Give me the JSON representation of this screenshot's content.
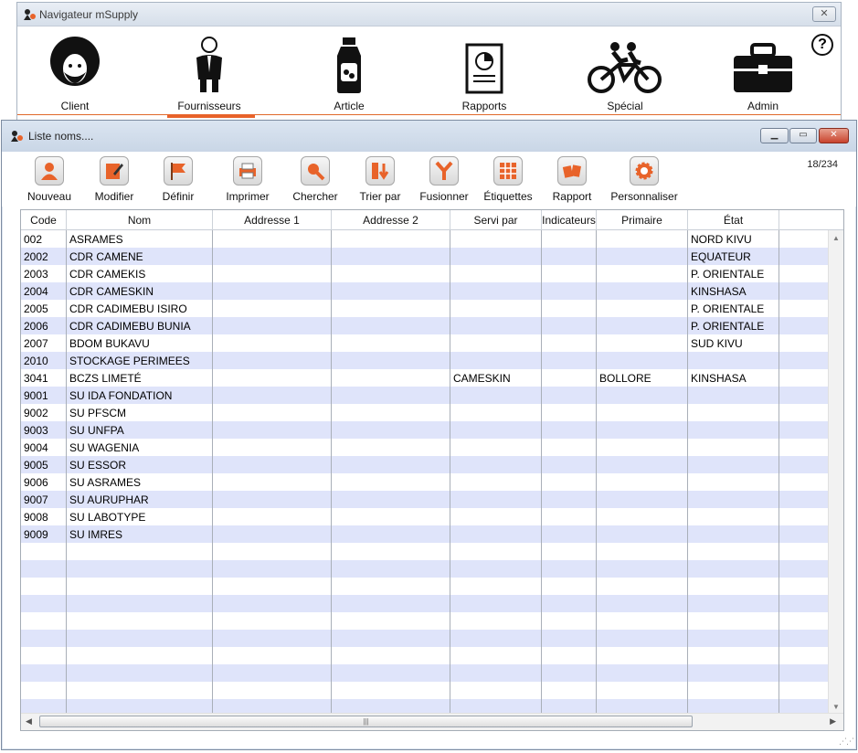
{
  "navigator": {
    "title": "Navigateur mSupply",
    "close_glyph": "✕",
    "help_glyph": "?",
    "items": [
      {
        "label": "Client",
        "icon": "client-icon"
      },
      {
        "label": "Fournisseurs",
        "icon": "supplier-icon",
        "selected": true
      },
      {
        "label": "Article",
        "icon": "item-bottle-icon"
      },
      {
        "label": "Rapports",
        "icon": "report-icon"
      },
      {
        "label": "Spécial",
        "icon": "tandem-bike-icon",
        "bold": true
      },
      {
        "label": "Admin",
        "icon": "toolbox-icon"
      }
    ],
    "accent": "#e8632a"
  },
  "list_window": {
    "title": "Liste noms....",
    "record_count": "18/234",
    "toolbar": [
      {
        "label": "Nouveau",
        "icon": "new-person-icon"
      },
      {
        "label": "Modifier",
        "icon": "edit-icon"
      },
      {
        "label": "Définir",
        "icon": "flag-icon"
      },
      {
        "label": "Imprimer",
        "icon": "print-icon"
      },
      {
        "label": "Chercher",
        "icon": "search-icon"
      },
      {
        "label": "Trier par",
        "icon": "sort-icon"
      },
      {
        "label": "Fusionner",
        "icon": "merge-icon"
      },
      {
        "label": "Étiquettes",
        "icon": "labels-icon"
      },
      {
        "label": "Rapport",
        "icon": "report-cards-icon"
      },
      {
        "label": "Personnaliser",
        "icon": "gear-icon"
      }
    ],
    "columns": [
      "Code",
      "Nom",
      "Addresse 1",
      "Addresse 2",
      "Servi par",
      "Indicateurs",
      "Primaire",
      "État"
    ],
    "rows": [
      {
        "code": "002",
        "nom": "ASRAMES",
        "addr1": "",
        "addr2": "",
        "servi": "",
        "ind": "",
        "prim": "",
        "etat": "NORD KIVU"
      },
      {
        "code": "2002",
        "nom": "CDR CAMENE",
        "addr1": "",
        "addr2": "",
        "servi": "",
        "ind": "",
        "prim": "",
        "etat": "EQUATEUR"
      },
      {
        "code": "2003",
        "nom": "CDR CAMEKIS",
        "addr1": "",
        "addr2": "",
        "servi": "",
        "ind": "",
        "prim": "",
        "etat": "P. ORIENTALE"
      },
      {
        "code": "2004",
        "nom": "CDR CAMESKIN",
        "addr1": "",
        "addr2": "",
        "servi": "",
        "ind": "",
        "prim": "",
        "etat": "KINSHASA"
      },
      {
        "code": "2005",
        "nom": "CDR CADIMEBU ISIRO",
        "addr1": "",
        "addr2": "",
        "servi": "",
        "ind": "",
        "prim": "",
        "etat": "P. ORIENTALE"
      },
      {
        "code": "2006",
        "nom": "CDR CADIMEBU BUNIA",
        "addr1": "",
        "addr2": "",
        "servi": "",
        "ind": "",
        "prim": "",
        "etat": "P. ORIENTALE"
      },
      {
        "code": "2007",
        "nom": "BDOM BUKAVU",
        "addr1": "",
        "addr2": "",
        "servi": "",
        "ind": "",
        "prim": "",
        "etat": "SUD KIVU"
      },
      {
        "code": "2010",
        "nom": "STOCKAGE PERIMEES",
        "addr1": "",
        "addr2": "",
        "servi": "",
        "ind": "",
        "prim": "",
        "etat": ""
      },
      {
        "code": "3041",
        "nom": "BCZS LIMETÉ",
        "addr1": "",
        "addr2": "",
        "servi": "CAMESKIN",
        "ind": "",
        "prim": "BOLLORE",
        "etat": "KINSHASA"
      },
      {
        "code": "9001",
        "nom": "SU IDA FONDATION",
        "addr1": "",
        "addr2": "",
        "servi": "",
        "ind": "",
        "prim": "",
        "etat": ""
      },
      {
        "code": "9002",
        "nom": "SU PFSCM",
        "addr1": "",
        "addr2": "",
        "servi": "",
        "ind": "",
        "prim": "",
        "etat": ""
      },
      {
        "code": "9003",
        "nom": "SU UNFPA",
        "addr1": "",
        "addr2": "",
        "servi": "",
        "ind": "",
        "prim": "",
        "etat": ""
      },
      {
        "code": "9004",
        "nom": "SU WAGENIA",
        "addr1": "",
        "addr2": "",
        "servi": "",
        "ind": "",
        "prim": "",
        "etat": ""
      },
      {
        "code": "9005",
        "nom": "SU ESSOR",
        "addr1": "",
        "addr2": "",
        "servi": "",
        "ind": "",
        "prim": "",
        "etat": ""
      },
      {
        "code": "9006",
        "nom": "SU ASRAMES",
        "addr1": "",
        "addr2": "",
        "servi": "",
        "ind": "",
        "prim": "",
        "etat": ""
      },
      {
        "code": "9007",
        "nom": "SU AURUPHAR",
        "addr1": "",
        "addr2": "",
        "servi": "",
        "ind": "",
        "prim": "",
        "etat": ""
      },
      {
        "code": "9008",
        "nom": "SU LABOTYPE",
        "addr1": "",
        "addr2": "",
        "servi": "",
        "ind": "",
        "prim": "",
        "etat": ""
      },
      {
        "code": "9009",
        "nom": "SU IMRES",
        "addr1": "",
        "addr2": "",
        "servi": "",
        "ind": "",
        "prim": "",
        "etat": ""
      }
    ],
    "row_stripe_color": "#dfe4fa"
  }
}
